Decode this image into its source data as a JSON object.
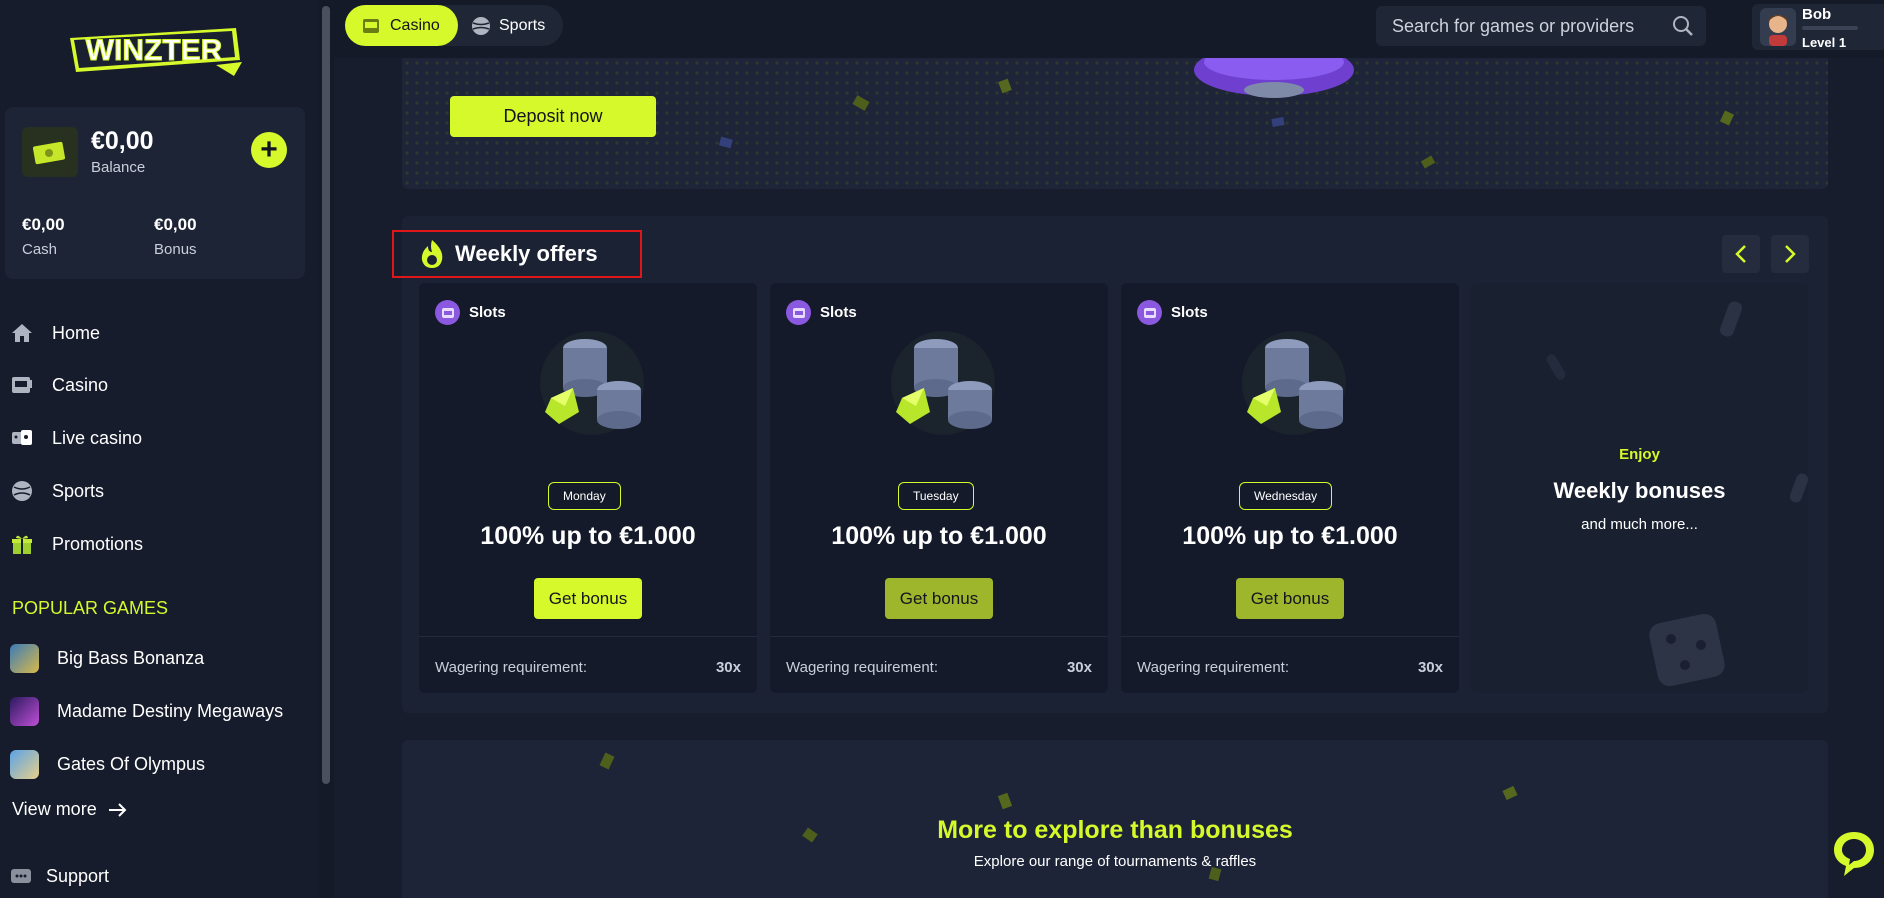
{
  "brand": {
    "logo_text": "WINZTER"
  },
  "wallet": {
    "balance": "€0,00",
    "balance_label": "Balance",
    "cash_amount": "€0,00",
    "cash_label": "Cash",
    "bonus_amount": "€0,00",
    "bonus_label": "Bonus"
  },
  "nav": {
    "home": "Home",
    "casino": "Casino",
    "live_casino": "Live casino",
    "sports": "Sports",
    "promotions": "Promotions"
  },
  "popular": {
    "title": "POPULAR GAMES",
    "games": [
      "Big Bass Bonanza",
      "Madame Destiny Megaways",
      "Gates Of Olympus"
    ],
    "view_more": "View more"
  },
  "support": "Support",
  "topbar": {
    "tab_casino": "Casino",
    "tab_sports": "Sports",
    "search_placeholder": "Search for games or providers",
    "user_name": "Bob",
    "user_level": "Level 1"
  },
  "hero": {
    "deposit_label": "Deposit now"
  },
  "offers": {
    "title": "Weekly offers",
    "cards": [
      {
        "category": "Slots",
        "day": "Monday",
        "amount": "100% up to €1.000",
        "button": "Get bonus",
        "wager_label": "Wagering requirement:",
        "wager_value": "30x"
      },
      {
        "category": "Slots",
        "day": "Tuesday",
        "amount": "100% up to €1.000",
        "button": "Get bonus",
        "wager_label": "Wagering requirement:",
        "wager_value": "30x"
      },
      {
        "category": "Slots",
        "day": "Wednesday",
        "amount": "100% up to €1.000",
        "button": "Get bonus",
        "wager_label": "Wagering requirement:",
        "wager_value": "30x"
      }
    ],
    "enjoy": {
      "small": "Enjoy",
      "title": "Weekly bonuses",
      "subtitle": "and much more..."
    }
  },
  "explore": {
    "title": "More to explore than bonuses",
    "subtitle": "Explore our range of tournaments & raffles"
  },
  "colors": {
    "accent": "#d5f92a",
    "accent_muted": "#9eb62b",
    "bg": "#171d2d",
    "panel": "#1b2234",
    "highlight_border": "#e0161b"
  }
}
